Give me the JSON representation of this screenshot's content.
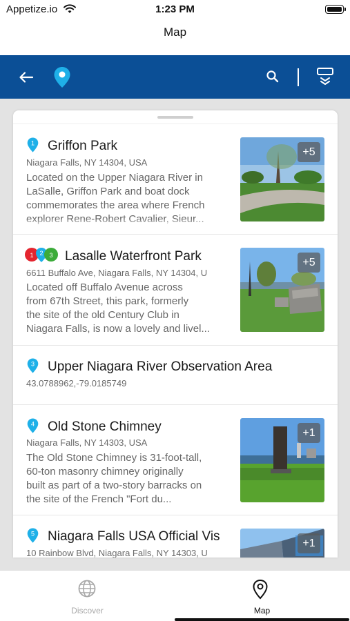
{
  "status_bar": {
    "carrier": "Appetize.io",
    "time": "1:23 PM"
  },
  "page_title": "Map",
  "colors": {
    "toolbar_blue": "#0b4f96",
    "pin_cyan": "#1fb0e8",
    "tab_active": "#111111",
    "tab_inactive": "#a9a9a9"
  },
  "toolbar": {
    "back_icon": "arrow-left-icon",
    "location_icon": "map-pin-icon",
    "search_icon": "search-icon",
    "filter_icon": "filter-icon"
  },
  "places": [
    {
      "number": "1",
      "title": "Griffon Park",
      "address": "Niagara Falls, NY 14304, USA",
      "description": [
        "Located on the Upper Niagara River in",
        "LaSalle, Griffon Park and boat dock",
        "commemorates the area where French",
        "explorer Rene-Robert Cavalier, Sieur..."
      ],
      "photo_count": "+5"
    },
    {
      "numbers": [
        "1",
        "2",
        "3"
      ],
      "title": "Lasalle Waterfront Park",
      "address": "6611 Buffalo Ave, Niagara Falls, NY 14304, U",
      "description": [
        "Located off Buffalo Avenue across",
        "from 67th Street, this park, formerly",
        "the site of the old Century Club in",
        "Niagara Falls, is now a lovely and livel..."
      ],
      "photo_count": "+5"
    },
    {
      "number": "3",
      "title": "Upper Niagara River Observation Area",
      "address": "43.0788962,-79.0185749"
    },
    {
      "number": "4",
      "title": "Old Stone Chimney",
      "address": "Niagara Falls, NY 14303, USA",
      "description": [
        "The Old Stone Chimney is 31-foot-tall,",
        "60-ton masonry chimney originally",
        "built as part of a two-story barracks on",
        "the site of the French \"Fort du..."
      ],
      "photo_count": "+1"
    },
    {
      "number": "5",
      "title": "Niagara Falls USA Official Vis",
      "address": "10 Rainbow Blvd, Niagara Falls, NY 14303, U",
      "photo_count": "+1"
    }
  ],
  "tabs": [
    {
      "label": "Discover",
      "icon": "globe-icon",
      "active": false
    },
    {
      "label": "Map",
      "icon": "map-pin-outline-icon",
      "active": true
    }
  ]
}
